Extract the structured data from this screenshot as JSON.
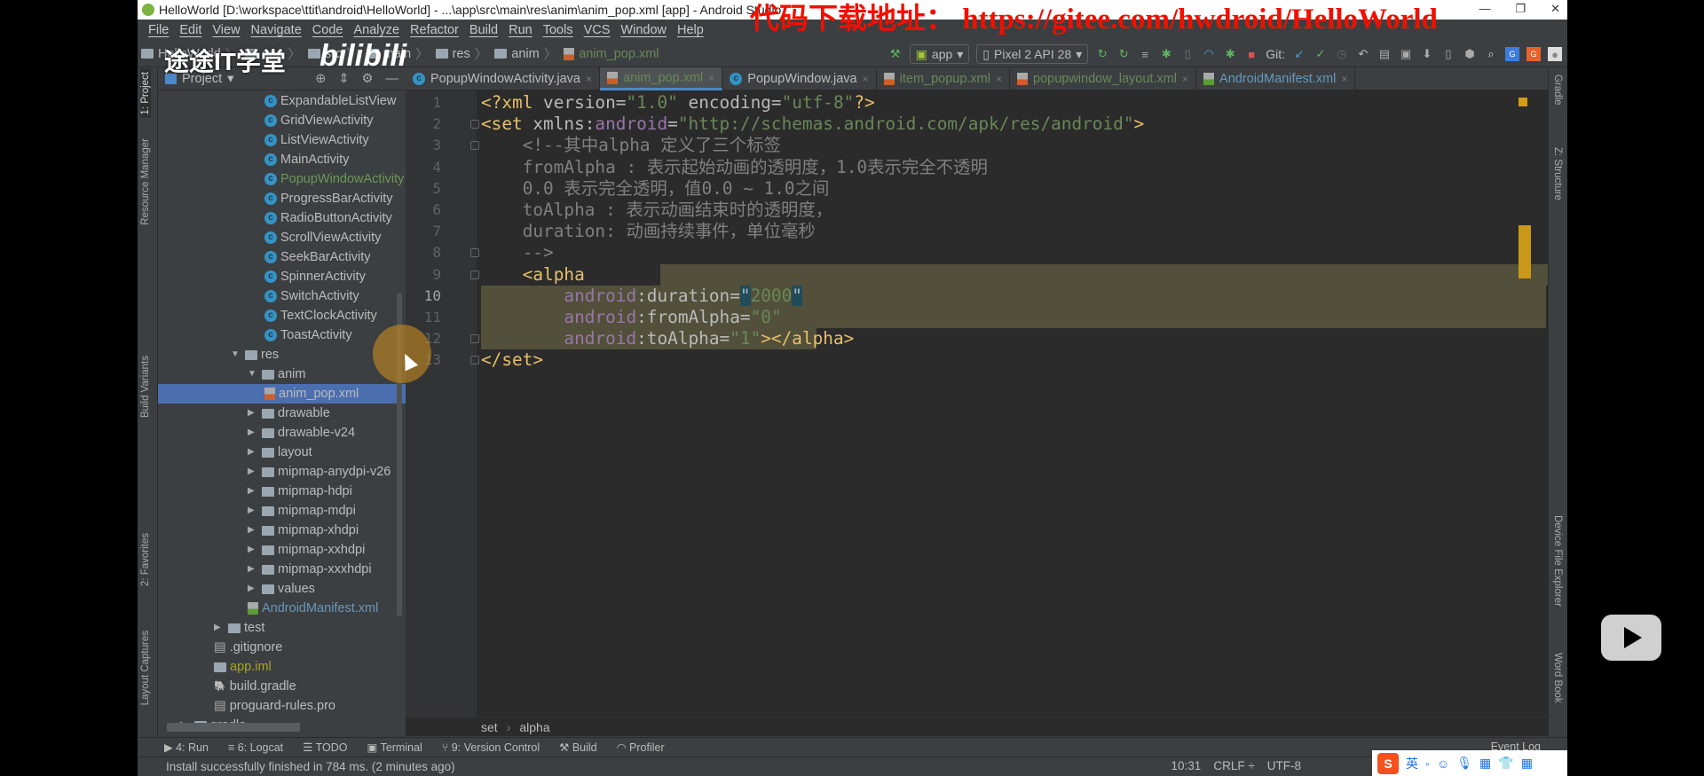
{
  "window": {
    "title": "HelloWorld [D:\\workspace\\ttit\\android\\HelloWorld] - ...\\app\\src\\main\\res\\anim\\anim_pop.xml [app] - Android Studio",
    "controls": [
      "—",
      "❐",
      "✕"
    ]
  },
  "menu": [
    "File",
    "Edit",
    "View",
    "Navigate",
    "Code",
    "Analyze",
    "Refactor",
    "Build",
    "Run",
    "Tools",
    "VCS",
    "Window",
    "Help"
  ],
  "breadcrumb": [
    "HelloWorld",
    "app",
    "src",
    "main",
    "res",
    "anim",
    "anim_pop.xml"
  ],
  "toolbar": {
    "run_config": "app",
    "device": "Pixel 2 API 28",
    "git_label": "Git:",
    "icons": [
      "hammer-icon",
      "rerun-icon",
      "apply-changes-icon",
      "sync-icon",
      "debug-icon",
      "attach-icon",
      "profile-icon",
      "debug-attach-icon",
      "stop-icon",
      "git-update-icon",
      "git-commit-icon",
      "history-icon",
      "revert-icon",
      "project-structure-icon",
      "avd-icon",
      "sdk-icon",
      "device-icon",
      "search-icon",
      "translate-icon"
    ]
  },
  "project_panel": {
    "title": "Project",
    "tree": [
      {
        "label": "ExpandableListView",
        "depth": 5,
        "icon": "class",
        "color": "#bbbbbb"
      },
      {
        "label": "GridViewActivity",
        "depth": 5,
        "icon": "class",
        "color": "#bbbbbb"
      },
      {
        "label": "ListViewActivity",
        "depth": 5,
        "icon": "class",
        "color": "#bbbbbb"
      },
      {
        "label": "MainActivity",
        "depth": 5,
        "icon": "class",
        "color": "#bbbbbb"
      },
      {
        "label": "PopupWindowActivity",
        "depth": 5,
        "icon": "class",
        "color": "#6a9955"
      },
      {
        "label": "ProgressBarActivity",
        "depth": 5,
        "icon": "class",
        "color": "#bbbbbb"
      },
      {
        "label": "RadioButtonActivity",
        "depth": 5,
        "icon": "class",
        "color": "#bbbbbb"
      },
      {
        "label": "ScrollViewActivity",
        "depth": 5,
        "icon": "class",
        "color": "#bbbbbb"
      },
      {
        "label": "SeekBarActivity",
        "depth": 5,
        "icon": "class",
        "color": "#bbbbbb"
      },
      {
        "label": "SpinnerActivity",
        "depth": 5,
        "icon": "class",
        "color": "#bbbbbb"
      },
      {
        "label": "SwitchActivity",
        "depth": 5,
        "icon": "class",
        "color": "#bbbbbb"
      },
      {
        "label": "TextClockActivity",
        "depth": 5,
        "icon": "class",
        "color": "#bbbbbb"
      },
      {
        "label": "ToastActivity",
        "depth": 5,
        "icon": "class",
        "color": "#bbbbbb"
      },
      {
        "label": "res",
        "depth": 3,
        "icon": "folder",
        "expanded": true,
        "color": "#bbbbbb"
      },
      {
        "label": "anim",
        "depth": 4,
        "icon": "folder",
        "expanded": true,
        "color": "#bbbbbb"
      },
      {
        "label": "anim_pop.xml",
        "depth": 5,
        "icon": "xml",
        "color": "#bbbbbb",
        "selected": true
      },
      {
        "label": "drawable",
        "depth": 4,
        "icon": "folder",
        "expanded": false,
        "color": "#bbbbbb"
      },
      {
        "label": "drawable-v24",
        "depth": 4,
        "icon": "folder",
        "expanded": false,
        "color": "#bbbbbb"
      },
      {
        "label": "layout",
        "depth": 4,
        "icon": "folder",
        "expanded": false,
        "color": "#bbbbbb"
      },
      {
        "label": "mipmap-anydpi-v26",
        "depth": 4,
        "icon": "folder",
        "expanded": false,
        "color": "#bbbbbb"
      },
      {
        "label": "mipmap-hdpi",
        "depth": 4,
        "icon": "folder",
        "expanded": false,
        "color": "#bbbbbb"
      },
      {
        "label": "mipmap-mdpi",
        "depth": 4,
        "icon": "folder",
        "expanded": false,
        "color": "#bbbbbb"
      },
      {
        "label": "mipmap-xhdpi",
        "depth": 4,
        "icon": "folder",
        "expanded": false,
        "color": "#bbbbbb"
      },
      {
        "label": "mipmap-xxhdpi",
        "depth": 4,
        "icon": "folder",
        "expanded": false,
        "color": "#bbbbbb"
      },
      {
        "label": "mipmap-xxxhdpi",
        "depth": 4,
        "icon": "folder",
        "expanded": false,
        "color": "#bbbbbb"
      },
      {
        "label": "values",
        "depth": 4,
        "icon": "folder",
        "expanded": false,
        "color": "#bbbbbb"
      },
      {
        "label": "AndroidManifest.xml",
        "depth": 4,
        "icon": "manifest",
        "color": "#6897bb"
      },
      {
        "label": "test",
        "depth": 2,
        "icon": "folder",
        "expanded": false,
        "color": "#bbbbbb"
      },
      {
        "label": ".gitignore",
        "depth": 2,
        "icon": "file",
        "color": "#bbbbbb"
      },
      {
        "label": "app.iml",
        "depth": 2,
        "icon": "module",
        "color": "#a5a523"
      },
      {
        "label": "build.gradle",
        "depth": 2,
        "icon": "gradle",
        "color": "#bbbbbb"
      },
      {
        "label": "proguard-rules.pro",
        "depth": 2,
        "icon": "file",
        "color": "#bbbbbb"
      },
      {
        "label": "gradle",
        "depth": 0,
        "icon": "folder",
        "expanded": false,
        "color": "#bbbbbb"
      }
    ]
  },
  "left_stripe": [
    "1: Project",
    "Resource Manager",
    "Build Variants",
    "2: Favorites",
    "Layout Captures"
  ],
  "right_stripe": [
    "Gradle",
    "Z: Structure",
    "Device File Explorer",
    "Word Book"
  ],
  "tabs": [
    {
      "label": "PopupWindowActivity.java",
      "icon": "class",
      "style": "normal"
    },
    {
      "label": "anim_pop.xml",
      "icon": "xml",
      "style": "active"
    },
    {
      "label": "PopupWindow.java",
      "icon": "class",
      "style": "normal"
    },
    {
      "label": "item_popup.xml",
      "icon": "xml",
      "style": "green"
    },
    {
      "label": "popupwindow_layout.xml",
      "icon": "xml",
      "style": "green"
    },
    {
      "label": "AndroidManifest.xml",
      "icon": "manifest",
      "style": "blue"
    }
  ],
  "editor": {
    "current_line": 10,
    "lines": [
      [
        {
          "t": "<?xml ",
          "k": "tag"
        },
        {
          "t": "version",
          "k": "attr"
        },
        {
          "t": "=",
          "k": "punct"
        },
        {
          "t": "\"1.0\"",
          "k": "str"
        },
        {
          "t": " encoding",
          "k": "attr"
        },
        {
          "t": "=",
          "k": "punct"
        },
        {
          "t": "\"utf-8\"",
          "k": "str"
        },
        {
          "t": "?>",
          "k": "tag"
        }
      ],
      [
        {
          "t": "<set ",
          "k": "tag"
        },
        {
          "t": "xmlns:",
          "k": "attr"
        },
        {
          "t": "android",
          "k": "ns"
        },
        {
          "t": "=",
          "k": "punct"
        },
        {
          "t": "\"http://schemas.android.com/apk/res/android\"",
          "k": "str"
        },
        {
          "t": ">",
          "k": "tag"
        }
      ],
      [
        {
          "t": "    <!--其中alpha 定义了三个标签",
          "k": "cmt"
        }
      ],
      [
        {
          "t": "    fromAlpha : 表示起始动画的透明度，1.0表示完全不透明",
          "k": "cmt"
        }
      ],
      [
        {
          "t": "    0.0 表示完全透明，值0.0 ~ 1.0之间",
          "k": "cmt"
        }
      ],
      [
        {
          "t": "    toAlpha : 表示动画结束时的透明度，",
          "k": "cmt"
        }
      ],
      [
        {
          "t": "    duration: 动画持续事件，单位毫秒",
          "k": "cmt"
        }
      ],
      [
        {
          "t": "    -->",
          "k": "cmt"
        }
      ],
      [
        {
          "t": "    <alpha",
          "k": "tag"
        }
      ],
      [
        {
          "t": "        android",
          "k": "ns"
        },
        {
          "t": ":duration",
          "k": "attr"
        },
        {
          "t": "=",
          "k": "punct"
        },
        {
          "t": "\"",
          "k": "caret"
        },
        {
          "t": "2000",
          "k": "str"
        },
        {
          "t": "\"",
          "k": "caret"
        }
      ],
      [
        {
          "t": "        android",
          "k": "ns"
        },
        {
          "t": ":fromAlpha",
          "k": "attr"
        },
        {
          "t": "=",
          "k": "punct"
        },
        {
          "t": "\"0\"",
          "k": "str"
        }
      ],
      [
        {
          "t": "        android",
          "k": "ns"
        },
        {
          "t": ":toAlpha",
          "k": "attr"
        },
        {
          "t": "=",
          "k": "punct"
        },
        {
          "t": "\"1\"",
          "k": "str"
        },
        {
          "t": "></alpha>",
          "k": "tag"
        }
      ],
      [
        {
          "t": "</set>",
          "k": "tag"
        }
      ]
    ],
    "breadcrumb": [
      "set",
      "alpha"
    ]
  },
  "bottom_tools": [
    "4: Run",
    "6: Logcat",
    "TODO",
    "Terminal",
    "9: Version Control",
    "Build",
    "Profiler"
  ],
  "event_log": "Event Log",
  "status": {
    "message": "Install successfully finished in 784 ms. (2 minutes ago)",
    "position": "10:31",
    "line_sep": "CRLF ÷",
    "encoding": "UTF-8"
  },
  "ime": {
    "logo": "S",
    "lang": "英"
  },
  "overlays": {
    "watermark_text": "代码下载地址： https://gitee.com/hwdroid/HelloWorld",
    "channel_logo": "途途IT学堂",
    "platform_logo": "bilibili"
  },
  "colors": {
    "tag": "#e8bf6a",
    "string": "#6a8759",
    "namespace": "#9876aa",
    "comment": "#808080",
    "selection": "#4b6eaf",
    "highlight": "#52503a"
  }
}
